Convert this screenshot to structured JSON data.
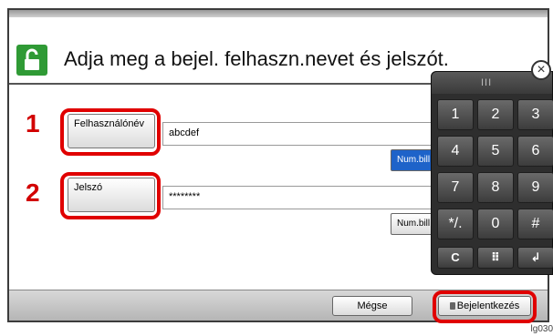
{
  "header": {
    "instruction": "Adja meg a bejel. felhaszn.nevet és jelszót."
  },
  "fields": [
    {
      "step": "1",
      "label": "Felhasználónév",
      "value": "abcdef",
      "numbill_label": "Num.bill."
    },
    {
      "step": "2",
      "label": "Jelszó",
      "value": "********",
      "numbill_label": "Num.bill."
    }
  ],
  "keypad": {
    "grip": "III",
    "close_symbol": "×",
    "keys": [
      "1",
      "2",
      "3",
      "4",
      "5",
      "6",
      "7",
      "8",
      "9",
      "*/.",
      "0",
      "#"
    ],
    "clear_label": "C",
    "menu_symbol": "⠿",
    "enter_symbol": "↲"
  },
  "footer": {
    "cancel_label": "Mégse",
    "login_label": "Bejelentkezés"
  },
  "figure_code": "lg030",
  "colors": {
    "callout": "#e00000",
    "step_number": "#d20000",
    "lock_icon": "#2f9a35",
    "active_numbill": "#1e63c9"
  }
}
